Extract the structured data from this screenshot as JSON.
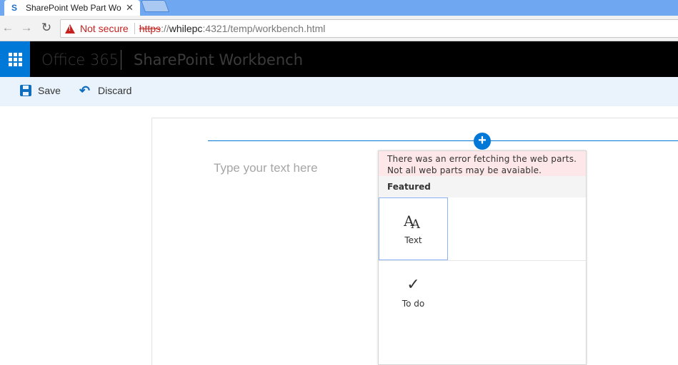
{
  "browser": {
    "tab_title": "SharePoint Web Part Wo",
    "tab_close": "✕",
    "security_label": "Not secure",
    "url_scheme": "https",
    "url_separator": "://",
    "url_host": "whilepc",
    "url_path": ":4321/temp/workbench.html"
  },
  "suitebar": {
    "brand": "Office 365",
    "app_name": "SharePoint Workbench"
  },
  "commands": {
    "save_label": "Save",
    "discard_label": "Discard"
  },
  "canvas": {
    "placeholder": "Type your text here",
    "add_symbol": "+"
  },
  "toolbox": {
    "error_message": "There was an error fetching the web parts. Not all web parts may be avaiable.",
    "section_heading": "Featured",
    "tiles": [
      {
        "label": "Text",
        "icon": "text-icon",
        "glyph": "AA"
      },
      {
        "label": "To do",
        "icon": "checkmark-icon",
        "glyph": "✓"
      }
    ]
  },
  "colors": {
    "accent": "#0078d7",
    "suitebar": "#000000",
    "error_bg": "#fde7e9",
    "not_secure": "#c5221f"
  }
}
